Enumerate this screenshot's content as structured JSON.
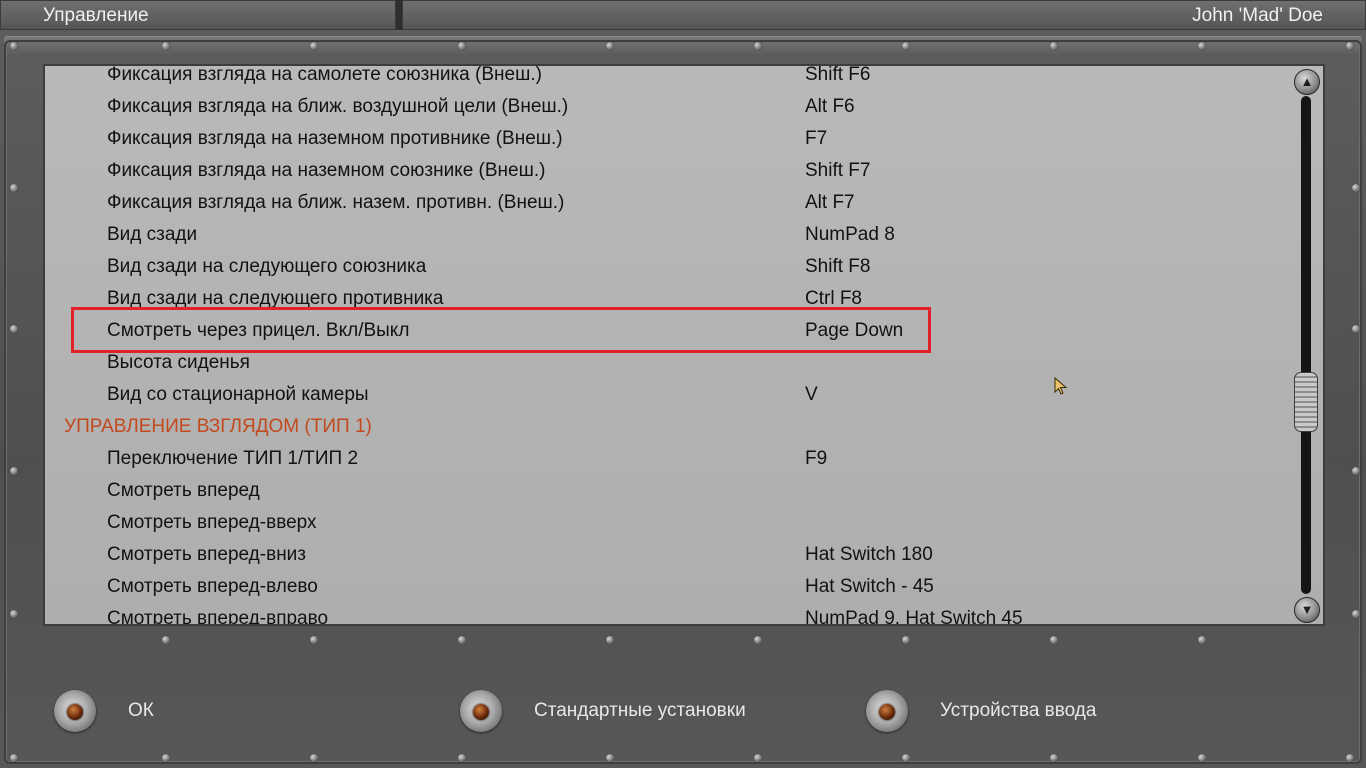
{
  "header": {
    "title": "Управление",
    "user": "John 'Mad' Doe"
  },
  "bindings": [
    {
      "action": "Фиксация взгляда на самолете союзника (Внеш.)",
      "key": "Shift F6"
    },
    {
      "action": "Фиксация взгляда на ближ. воздушной цели (Внеш.)",
      "key": "Alt F6"
    },
    {
      "action": "Фиксация взгляда на наземном противнике (Внеш.)",
      "key": "F7"
    },
    {
      "action": "Фиксация взгляда на наземном союзнике (Внеш.)",
      "key": "Shift F7"
    },
    {
      "action": "Фиксация взгляда на ближ. назем. противн. (Внеш.)",
      "key": "Alt F7"
    },
    {
      "action": "Вид сзади",
      "key": "NumPad 8"
    },
    {
      "action": "Вид сзади на следующего союзника",
      "key": "Shift F8"
    },
    {
      "action": "Вид сзади на следующего противника",
      "key": "Ctrl F8"
    },
    {
      "action": "Смотреть через прицел. Вкл/Выкл",
      "key": "Page Down"
    },
    {
      "action": "Высота сиденья",
      "key": ""
    },
    {
      "action": "Вид со стационарной камеры",
      "key": "V"
    },
    {
      "action": "УПРАВЛЕНИЕ ВЗГЛЯДОМ (ТИП 1)",
      "key": ""
    },
    {
      "action": "Переключение ТИП 1/ТИП 2",
      "key": "F9"
    },
    {
      "action": "Смотреть вперед",
      "key": ""
    },
    {
      "action": "Смотреть вперед-вверх",
      "key": ""
    },
    {
      "action": "Смотреть вперед-вниз",
      "key": "Hat Switch 180"
    },
    {
      "action": "Смотреть вперед-влево",
      "key": "Hat Switch - 45"
    },
    {
      "action": "Смотреть вперед-вправо",
      "key": "NumPad 9, Hat Switch 45"
    }
  ],
  "selected_index": 8,
  "section_index": 11,
  "scrollbar": {
    "up_icon": "arrow-up-icon",
    "down_icon": "arrow-down-icon"
  },
  "buttons": {
    "ok": "ОК",
    "defaults": "Стандартные установки",
    "input_devices": "Устройства ввода"
  },
  "colors": {
    "section_text": "#c24a1c",
    "highlight_border": "#e0212a",
    "panel_bg": "#b5b5b5"
  }
}
